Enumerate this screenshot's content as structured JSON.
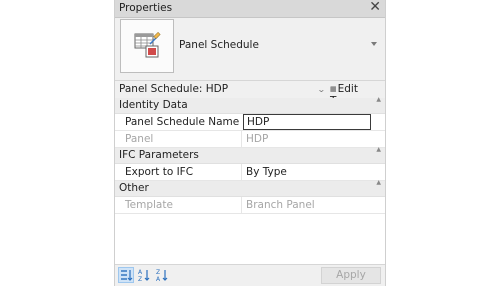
{
  "window": {
    "title": "Properties"
  },
  "type_selector": {
    "name": "Panel Schedule",
    "icon": "panel-schedule-icon"
  },
  "instance_selector": {
    "value": "Panel Schedule: HDP",
    "edit_type_label": "Edit Type"
  },
  "groups": [
    {
      "label": "Identity Data",
      "rows": [
        {
          "key": "Panel Schedule Name",
          "value": "HDP",
          "editable": true
        },
        {
          "key": "Panel",
          "value": "HDP",
          "editable": false
        }
      ]
    },
    {
      "label": "IFC Parameters",
      "rows": [
        {
          "key": "Export to IFC",
          "value": "By Type",
          "editable": true
        }
      ]
    },
    {
      "label": "Other",
      "rows": [
        {
          "key": "Template",
          "value": "Branch Panel",
          "editable": false
        }
      ]
    }
  ],
  "footer": {
    "sort_buttons": [
      "categorized-icon",
      "sort-ascending-icon",
      "sort-descending-icon"
    ],
    "apply_label": "Apply"
  },
  "colors": {
    "accent": "#3b78c4",
    "group_bg": "#ececec",
    "disabled_text": "#a6a6a6"
  }
}
